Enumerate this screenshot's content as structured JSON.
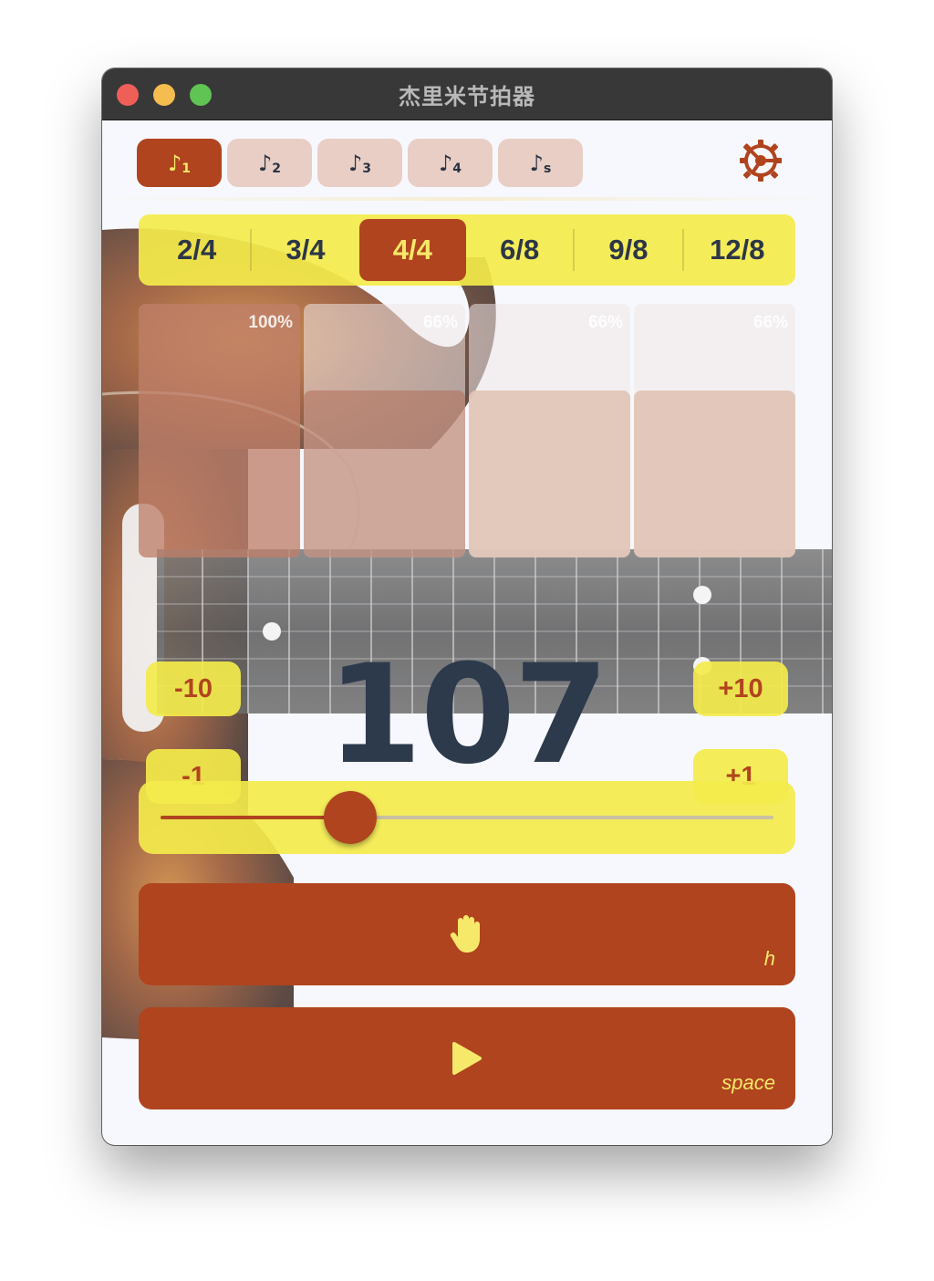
{
  "window": {
    "title": "杰里米节拍器"
  },
  "note_tabs": [
    {
      "sub": "1",
      "active": true
    },
    {
      "sub": "2",
      "active": false
    },
    {
      "sub": "3",
      "active": false
    },
    {
      "sub": "4",
      "active": false
    },
    {
      "sub": "s",
      "active": false
    }
  ],
  "note_glyph": "♪",
  "settings": {
    "icon": "gear-icon"
  },
  "time_signatures": [
    "2/4",
    "3/4",
    "4/4",
    "6/8",
    "9/8",
    "12/8"
  ],
  "time_signature_selected": "4/4",
  "beats": [
    {
      "label": "100%",
      "level": 1.0
    },
    {
      "label": "66%",
      "level": 0.66
    },
    {
      "label": "66%",
      "level": 0.66
    },
    {
      "label": "66%",
      "level": 0.66
    }
  ],
  "tempo": {
    "bpm": "107",
    "minus10": "-10",
    "minus1": "-1",
    "plus10": "+10",
    "plus1": "+1",
    "slider_fraction": 0.31
  },
  "tap_button": {
    "icon": "hand-icon",
    "hotkey": "h"
  },
  "play_button": {
    "icon": "play-icon",
    "hotkey": "space"
  },
  "colors": {
    "accent": "#b0441e",
    "yellow": "#f3ea4b",
    "text_dark": "#2c3a4c",
    "inactive_tab": "#e5c7bb"
  }
}
